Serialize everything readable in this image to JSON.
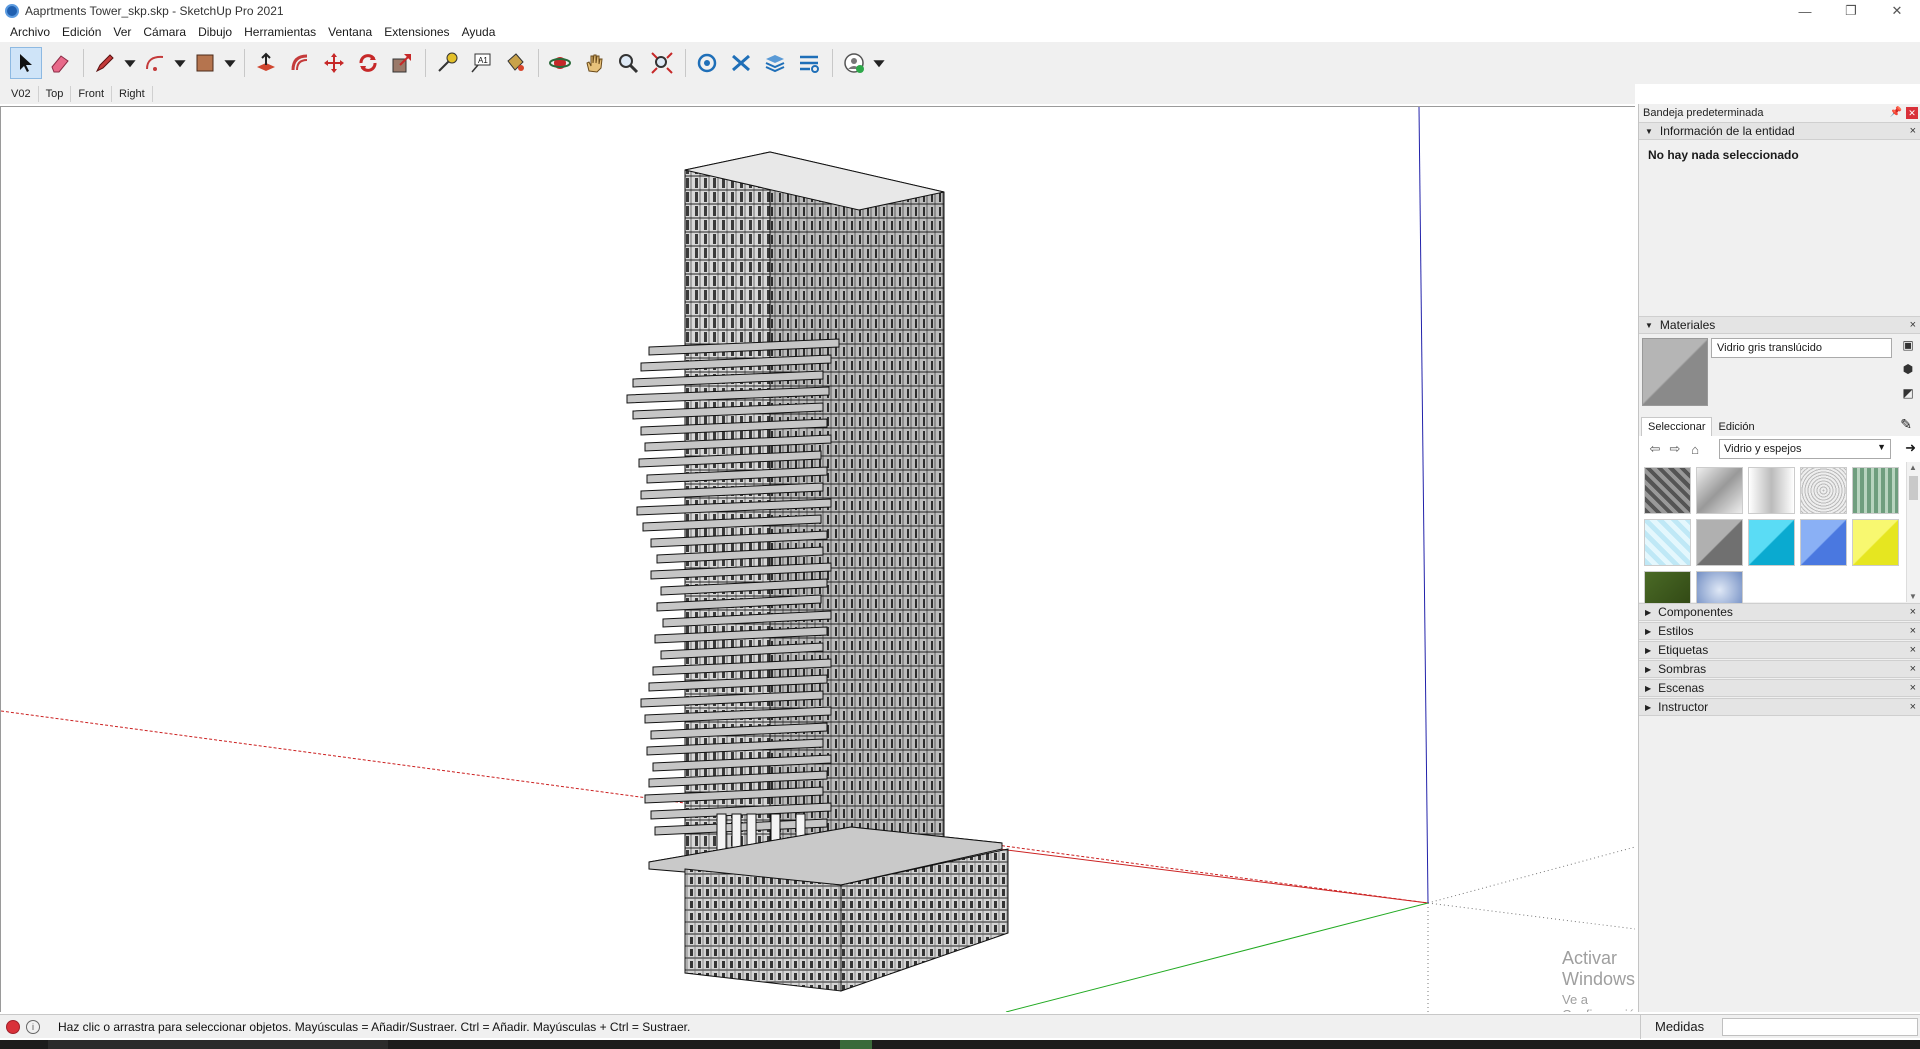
{
  "window": {
    "title": "Aaprtments Tower_skp.skp - SketchUp Pro 2021",
    "minimize_glyph": "—",
    "restore_glyph": "❐",
    "close_glyph": "✕"
  },
  "menu": [
    "Archivo",
    "Edición",
    "Ver",
    "Cámara",
    "Dibujo",
    "Herramientas",
    "Ventana",
    "Extensiones",
    "Ayuda"
  ],
  "toolbar": {
    "tools": [
      "select-icon",
      "eraser-icon",
      "pencil-line-icon",
      "arc-icon",
      "rectangle-icon",
      "push-pull-icon",
      "offset-icon",
      "move-icon",
      "rotate-icon",
      "scale-icon",
      "tape-measure-icon",
      "text-icon",
      "paint-bucket-icon",
      "orbit-icon",
      "pan-icon",
      "zoom-icon",
      "zoom-extents-icon",
      "warehouse-icon",
      "extension-warehouse-icon",
      "layout-icon",
      "extension-manager-icon",
      "profile-icon"
    ]
  },
  "scenes": [
    "V02",
    "Top",
    "Front",
    "Right"
  ],
  "viewport": {
    "axis_red": "#cc2222",
    "axis_green": "#22aa22",
    "axis_blue": "#2222aa",
    "watermark_line1": "Activar Windows",
    "watermark_line2": "Ve a Configuración para activar Windows."
  },
  "tray": {
    "title": "Bandeja predeterminada",
    "entity_info": {
      "header": "Información de la entidad",
      "status": "No hay nada seleccionado"
    },
    "materials": {
      "header": "Materiales",
      "current_name": "Vidrio gris translúcido",
      "tabs": [
        "Seleccionar",
        "Edición"
      ],
      "library": "Vidrio y espejos",
      "swatch_colors": [
        "#7a7a7a",
        "#d8d8d8",
        "#e4e4e4",
        "#c9c9c9",
        "#8fb39a",
        "#cfeefa",
        "#8a8a8a",
        "#18c4ea",
        "#6a93ee",
        "#f2f240",
        "#3d5a1c",
        "#9aaed4"
      ]
    },
    "collapsed_panels": [
      "Componentes",
      "Estilos",
      "Etiquetas",
      "Sombras",
      "Escenas",
      "Instructor"
    ]
  },
  "status": {
    "message": "Haz clic o arrastra para seleccionar objetos. Mayúsculas = Añadir/Sustraer. Ctrl = Añadir. Mayúsculas + Ctrl = Sustraer.",
    "measurements_label": "Medidas"
  }
}
